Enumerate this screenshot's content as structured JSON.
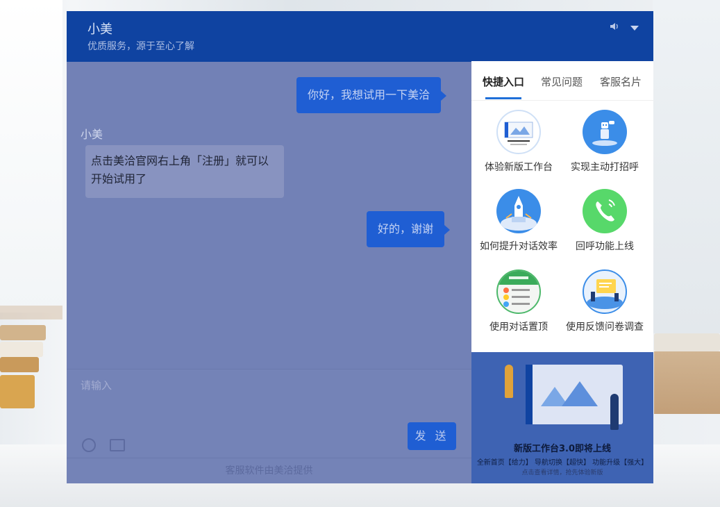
{
  "header": {
    "agent_name": "小美",
    "agent_subtitle": "优质服务，源于至心了解"
  },
  "messages": [
    {
      "side": "right",
      "text": "你好，我想试用一下美洽"
    },
    {
      "side": "left",
      "sender": "小美",
      "text": "点击美洽官网右上角「注册」就可以开始试用了"
    },
    {
      "side": "right",
      "text": "好的，谢谢"
    }
  ],
  "composer": {
    "placeholder": "请输入",
    "send_label": "发 送"
  },
  "footer": {
    "text": "客服软件由美洽提供"
  },
  "sidebar": {
    "tabs": [
      {
        "label": "快捷入口",
        "active": true
      },
      {
        "label": "常见问题",
        "active": false
      },
      {
        "label": "客服名片",
        "active": false
      }
    ],
    "quick_entries": [
      {
        "label": "体验新版工作台",
        "icon": "workbench-preview-icon"
      },
      {
        "label": "实现主动打招呼",
        "icon": "robot-greeting-icon"
      },
      {
        "label": "如何提升对话效率",
        "icon": "rocket-efficiency-icon"
      },
      {
        "label": "回呼功能上线",
        "icon": "phone-callback-icon"
      },
      {
        "label": "使用对话置顶",
        "icon": "pin-conversation-icon"
      },
      {
        "label": "使用反馈问卷调查",
        "icon": "feedback-survey-icon"
      }
    ]
  },
  "promo": {
    "title": "新版工作台3.0即将上线",
    "subtitle": "全新首页【给力】 导航切换【超快】 功能升级【强大】",
    "note": "点击查看详情，抢先体验新版"
  },
  "colors": {
    "header": "#0f43a1",
    "bubble": "#1f5ed3",
    "tab_accent": "#1f6fd8",
    "overlay": "#7483b7"
  }
}
